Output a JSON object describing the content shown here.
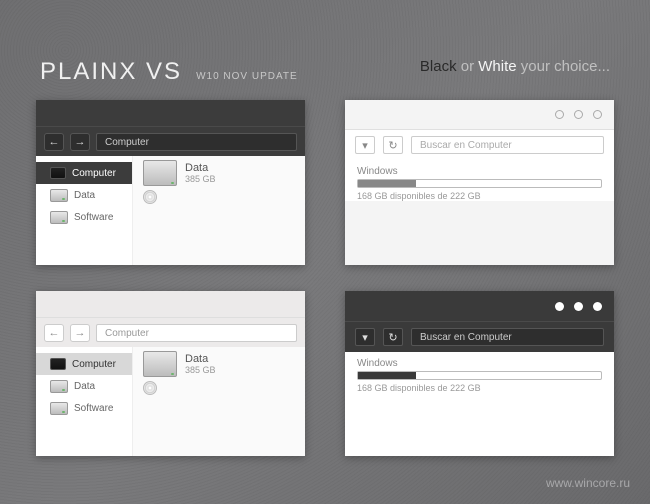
{
  "header": {
    "title": "PLAINX VS",
    "subtitle": "W10 NOV UPDATE",
    "tag_black": "Black",
    "tag_or": " or ",
    "tag_white": "White",
    "tag_tail": " your choice..."
  },
  "watermark": "www.wincore.ru",
  "explorer": {
    "address": "Computer",
    "tree": {
      "computer": "Computer",
      "data": "Data",
      "software": "Software"
    },
    "drive": {
      "name": "Data",
      "size": "385 GB"
    }
  },
  "detail": {
    "search_placeholder": "Buscar en Computer",
    "progress": {
      "label": "Windows",
      "fill_pct": 24,
      "subtext": "168 GB disponibles de 222 GB"
    }
  }
}
